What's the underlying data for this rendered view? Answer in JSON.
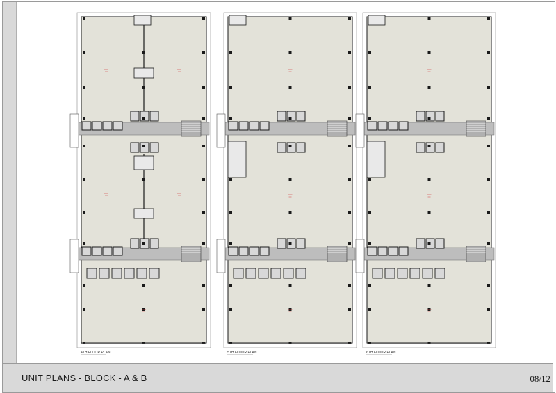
{
  "sheet": {
    "title": "UNIT PLANS - BLOCK - A & B",
    "page_number": "08/12"
  },
  "plans": [
    {
      "label": "4TH FLOOR PLAN"
    },
    {
      "label": "5TH FLOOR PLAN"
    },
    {
      "label": "6TH FLOOR PLAN"
    }
  ],
  "colors": {
    "floor_fill": "#e3e2d9",
    "corridor_fill": "#bdbdbd",
    "wall": "#1a1a1a",
    "column": "#1a1a1a",
    "frame_bg": "#d9d9d9",
    "unit_label": "#d23c3c"
  }
}
